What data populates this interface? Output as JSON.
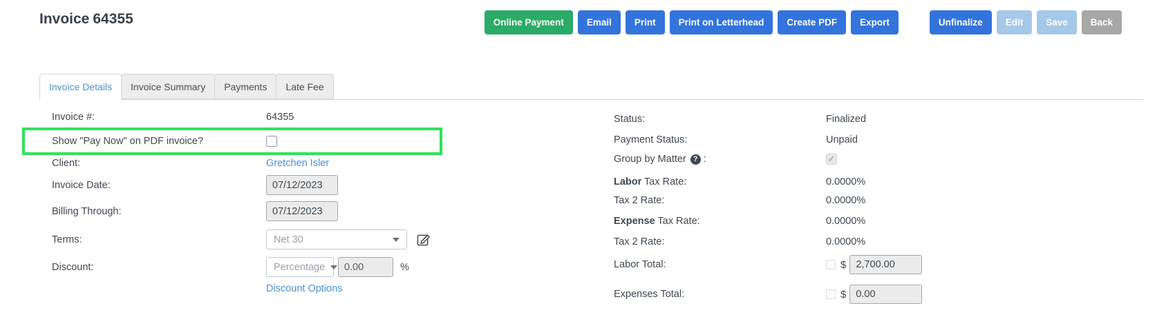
{
  "header": {
    "title_prefix": "Invoice",
    "title_number": "64355"
  },
  "toolbar": {
    "online_payment": "Online Payment",
    "email": "Email",
    "print": "Print",
    "print_on_letterhead": "Print on Letterhead",
    "create_pdf": "Create PDF",
    "export": "Export",
    "unfinalize": "Unfinalize",
    "edit": "Edit",
    "save": "Save",
    "back": "Back"
  },
  "tabs": {
    "invoice_details": "Invoice Details",
    "invoice_summary": "Invoice Summary",
    "payments": "Payments",
    "late_fee": "Late Fee"
  },
  "details": {
    "invoice_number_label": "Invoice #:",
    "invoice_number_value": "64355",
    "pay_now_label": "Show \"Pay Now\" on PDF invoice?",
    "pay_now_checked": false,
    "client_label": "Client:",
    "client_value": "Gretchen Isler",
    "invoice_date_label": "Invoice Date:",
    "invoice_date_value": "07/12/2023",
    "billing_through_label": "Billing Through:",
    "billing_through_value": "07/12/2023",
    "terms_label": "Terms:",
    "terms_value": "Net 30",
    "discount_label": "Discount:",
    "discount_type_value": "Percentage",
    "discount_amount_value": "0.00",
    "discount_unit": "%",
    "discount_options_link": "Discount Options"
  },
  "summary": {
    "status_label": "Status:",
    "status_value": "Finalized",
    "payment_status_label": "Payment Status:",
    "payment_status_value": "Unpaid",
    "group_by_matter_label": "Group by Matter",
    "group_by_matter_colon": ":",
    "group_by_matter_checked": true,
    "labor_tax_label_bold": "Labor",
    "labor_tax_label_rest": " Tax Rate:",
    "labor_tax_value": "0.0000%",
    "tax2_label": "Tax 2 Rate:",
    "tax2_value_1": "0.0000%",
    "expense_tax_label_bold": "Expense",
    "expense_tax_label_rest": " Tax Rate:",
    "expense_tax_value": "0.0000%",
    "tax2_value_2": "0.0000%",
    "labor_total_label": "Labor Total:",
    "labor_total_currency": "$",
    "labor_total_value": "2,700.00",
    "labor_total_checked": false,
    "expenses_total_label": "Expenses Total:",
    "expenses_total_currency": "$",
    "expenses_total_value": "0.00",
    "expenses_total_checked": false
  },
  "icons": {
    "help": "?",
    "checkmark": "✓"
  },
  "colors": {
    "button_blue": "#3274dc",
    "button_green": "#2aab67",
    "button_disabled_blue": "#a5c8e9",
    "button_gray": "#a7a7a7",
    "link_blue": "#4a90d2",
    "highlight_green": "#2de458"
  }
}
